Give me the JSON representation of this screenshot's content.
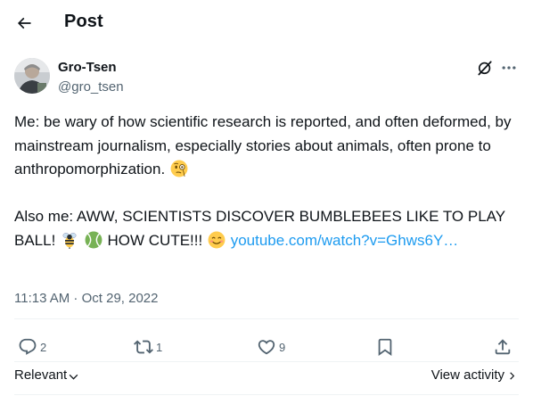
{
  "header": {
    "title": "Post"
  },
  "author": {
    "name": "Gro-Tsen",
    "handle": "@gro_tsen"
  },
  "post": {
    "paragraph1_text": "Me: be wary of how scientific research is reported, and often deformed, by mainstream journalism, especially stories about animals, often prone to anthropomorphization.",
    "paragraph2_text": "Also me: AWW, SCIENTISTS DISCOVER BUMBLEBEES LIKE TO PLAY BALL!",
    "paragraph2_after_emoji": "HOW CUTE!!!",
    "link_text": "youtube.com/watch?v=Ghws6Y…",
    "emojis": [
      "face-with-monocle",
      "honeybee",
      "tennis-ball",
      "smiling-face-with-smiling-eyes"
    ]
  },
  "timestamp": "11:13 AM · Oct 29, 2022",
  "actions": {
    "replies": "2",
    "reposts": "1",
    "likes": "9"
  },
  "footer": {
    "sort_label": "Relevant",
    "view_activity_label": "View activity"
  },
  "colors": {
    "text": "#0f1419",
    "secondary": "#536471",
    "link": "#1d9bf0",
    "divider": "#eff3f4"
  }
}
